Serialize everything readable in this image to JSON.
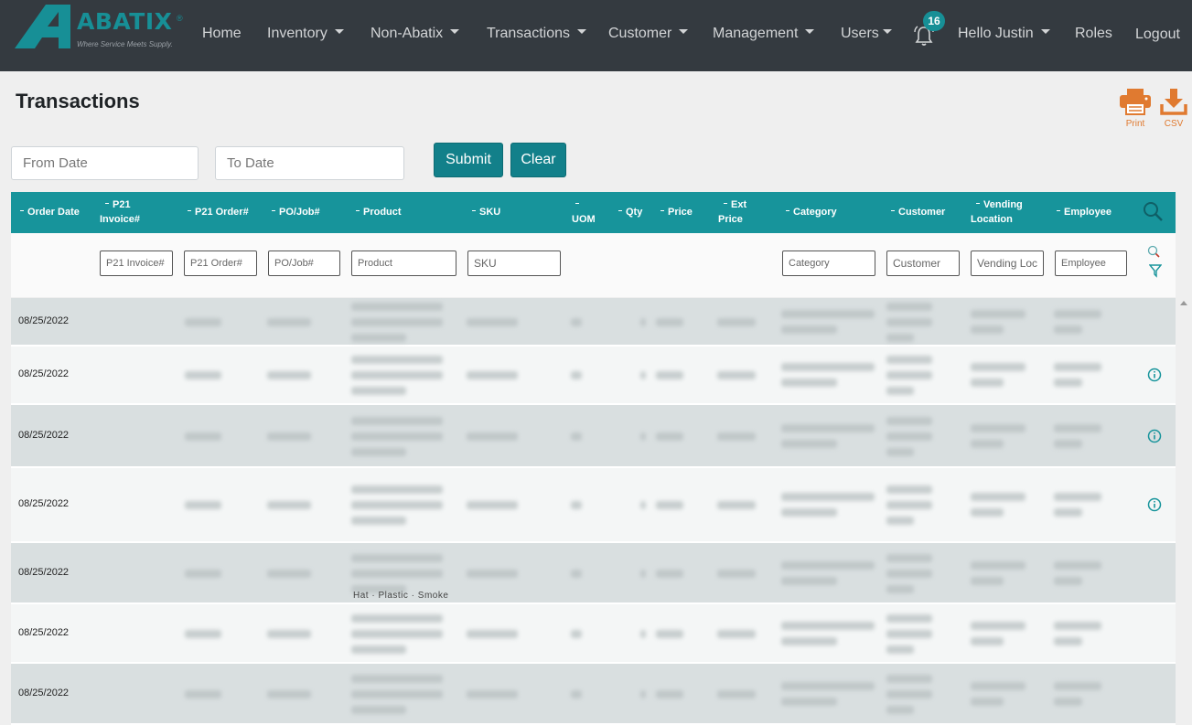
{
  "brand": {
    "name": "ABATIX",
    "registered": "®",
    "tagline": "Where Service Meets Supply.",
    "color": "#178f96"
  },
  "nav": {
    "items": [
      {
        "label": "Home",
        "dropdown": false
      },
      {
        "label": "Inventory",
        "dropdown": true
      },
      {
        "label": "Non-Abatix",
        "dropdown": true
      },
      {
        "label": "Transactions",
        "dropdown": true
      },
      {
        "label": "Customer",
        "dropdown": true
      },
      {
        "label": "Management",
        "dropdown": true
      },
      {
        "label": "Users",
        "dropdown": true
      }
    ],
    "notifications": {
      "count": "16",
      "icon": "bell-icon"
    },
    "user_menu": "Hello Justin",
    "roles": "Roles",
    "logout": "Logout"
  },
  "page": {
    "title": "Transactions",
    "print_label": "Print",
    "csv_label": "CSV"
  },
  "date_filter": {
    "from_placeholder": "From Date",
    "to_placeholder": "To Date",
    "submit": "Submit",
    "clear": "Clear"
  },
  "table": {
    "headers": [
      "Order Date",
      "P21 Invoice#",
      "P21 Order#",
      "PO/Job#",
      "Product",
      "SKU",
      "UOM",
      "Qty",
      "Price",
      "Ext Price",
      "Category",
      "Customer",
      "Vending Location",
      "Employee"
    ],
    "filters": {
      "invoice": "P21 Invoice#",
      "order": "P21 Order#",
      "po": "PO/Job#",
      "product": "Product",
      "sku": "SKU",
      "category": "Category",
      "customer": "Customer",
      "vending": "Vending Loc",
      "employee": "Employee"
    },
    "rows": [
      {
        "date": "08/25/2022",
        "info": false
      },
      {
        "date": "08/25/2022",
        "info": true
      },
      {
        "date": "08/25/2022",
        "info": true
      },
      {
        "date": "08/25/2022",
        "info": true
      },
      {
        "date": "08/25/2022",
        "info": false
      },
      {
        "date": "08/25/2022",
        "info": false
      },
      {
        "date": "08/25/2022",
        "info": false
      }
    ],
    "partial_text": "Hat  · Plastic · Smoke"
  },
  "colors": {
    "header_bg": "#343a40",
    "accent": "#17949b",
    "orange": "#e07a30"
  }
}
